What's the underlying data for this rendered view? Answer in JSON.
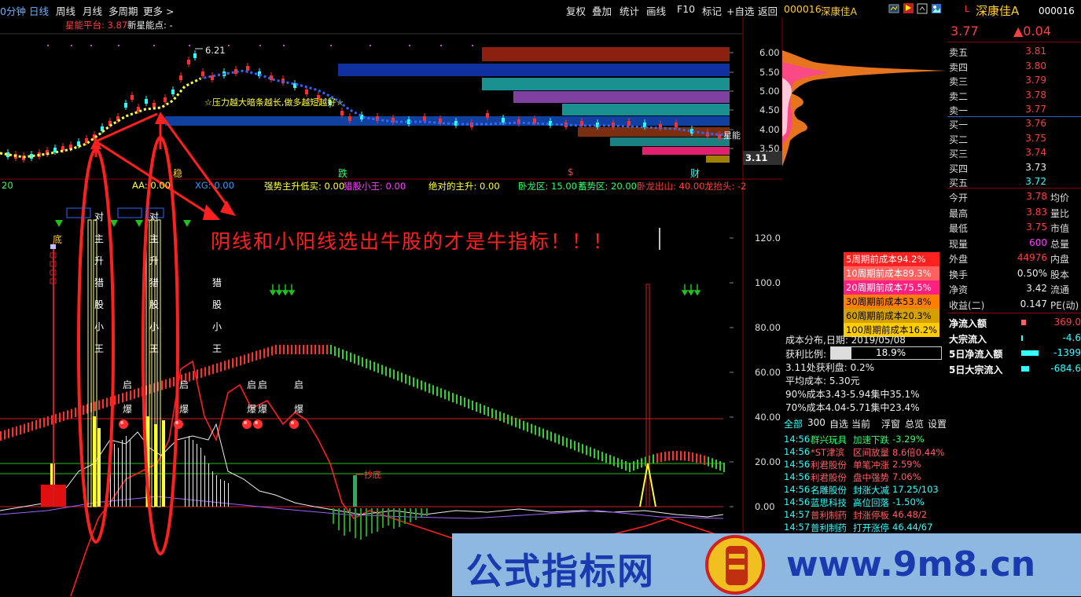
{
  "toolbar": {
    "left_items": [
      "0分钟",
      "日线",
      "周线",
      "月线",
      "多周期",
      "更多 >"
    ],
    "right_items": [
      "复权",
      "叠加",
      "统计",
      "画线",
      "F10",
      "标记",
      "+自选",
      "返回"
    ],
    "stock_code": "000016",
    "stock_name": "深康佳A"
  },
  "price_chart": {
    "indicator_label": "星能平台: 3.87",
    "indicator_label2": "新星能点: -",
    "high_marker": "6.21",
    "annotation": "☆压力越大暗条越长,做多越短越好☆",
    "y_axis": [
      "6.00",
      "5.50",
      "5.00",
      "4.50",
      "4.00",
      "3.50"
    ],
    "current_price_tag": "3.11",
    "side_label": "星能",
    "bottom_labels": [
      "稳",
      "跌",
      "$",
      "财"
    ]
  },
  "indicator_bar": {
    "items": [
      {
        "text": "20",
        "color": "#33ff66"
      },
      {
        "text": "AA: 0.00",
        "color": "#ffff33"
      },
      {
        "text": "XG: 0.00",
        "color": "#3399ff"
      },
      {
        "text": "强势主升低买: 0.00",
        "color": "#ffff33"
      },
      {
        "text": "猎股小王: 0.00",
        "color": "#ff40ff"
      },
      {
        "text": "绝对的主升: 0.00",
        "color": "#ffff33"
      },
      {
        "text": "卧龙区: 15.00",
        "color": "#33ff66"
      },
      {
        "text": "蓄势区: 20.00",
        "color": "#33ff66"
      },
      {
        "text": "卧龙出山: 40.00",
        "color": "#ff4040"
      },
      {
        "text": "龙抬头: -2",
        "color": "#ff4040"
      }
    ]
  },
  "lower_chart": {
    "headline": "阴线和小阳线选出牛股的才是牛指标！！！",
    "y_axis": [
      "120.0",
      "100.0",
      "80.00",
      "60.00",
      "40.00",
      "20.00",
      "0.00"
    ],
    "labels_bottom": "底",
    "vertical_text_1": [
      "对",
      "主",
      "升",
      "猎",
      "股",
      "小",
      "王"
    ],
    "vertical_text_2": [
      "对",
      "主",
      "升",
      "猎",
      "股",
      "小",
      "王"
    ],
    "vertical_text_3": [
      "猎",
      "股",
      "小",
      "王"
    ],
    "qibao": [
      "启",
      "爆"
    ],
    "yichao": "一抄底",
    "dots": "●"
  },
  "cost_distribution": {
    "boxes": [
      {
        "text": "5周期前成本94.2%",
        "color": "#ff2020",
        "fg": "#ffffff"
      },
      {
        "text": "10周期前成本89.3%",
        "color": "#ff6060",
        "fg": "#ffffff"
      },
      {
        "text": "20周期前成本75.5%",
        "color": "#ff2080",
        "fg": "#ffffff"
      },
      {
        "text": "30周期前成本53.8%",
        "color": "#ff7f00",
        "fg": "#000000"
      },
      {
        "text": "60周期前成本20.3%",
        "color": "#d4a000",
        "fg": "#000000"
      },
      {
        "text": "100周期前成本16.2%",
        "color": "#ffcc00",
        "fg": "#000000"
      }
    ],
    "date_line": "成本分布,日期: 2019/05/08",
    "profit_label": "获利比例:",
    "profit_value": "18.9%",
    "profit_fraction": 0.189,
    "profit_at": "3.11处获利盘: 0.2%",
    "avg_cost": "平均成本: 5.30元",
    "c90": "90%成本3.43-5.94集中35.1%",
    "c70": "70%成本4.04-5.71集中23.4%"
  },
  "ticker": {
    "tabs": [
      "全部",
      "300",
      "自选",
      "当前",
      "浮窗",
      "总览",
      "设置"
    ],
    "rows": [
      {
        "time": "14:56",
        "name": "群兴玩具",
        "event": "加速下跌",
        "value": "-3.29%",
        "color": "#33ff66"
      },
      {
        "time": "14:56",
        "name": "*ST津滨",
        "event": "区间放量",
        "value": "8.6倍0.44%",
        "color": "#ff6060"
      },
      {
        "time": "14:56",
        "name": "利君股份",
        "event": "单笔冲涨",
        "value": "2.59%",
        "color": "#ff6060"
      },
      {
        "time": "14:56",
        "name": "利君股份",
        "event": "盘中强势",
        "value": "7.06%",
        "color": "#ff6060"
      },
      {
        "time": "14:56",
        "name": "名雕股份",
        "event": "封涨大减",
        "value": "17.25/103",
        "color": "#33ffff"
      },
      {
        "time": "14:56",
        "name": "蓝思科技",
        "event": "高位回落",
        "value": "-1.50%",
        "color": "#33ffff"
      },
      {
        "time": "14:57",
        "name": "普利制药",
        "event": "封涨停板",
        "value": "46.48/2",
        "color": "#ff6060"
      },
      {
        "time": "14:57",
        "name": "普利制药",
        "event": "打开涨停",
        "value": "46.44/67",
        "color": "#33ffff"
      }
    ]
  },
  "quote": {
    "code": "000016",
    "name": "深康佳A",
    "price": "3.77",
    "change": "▲0.04",
    "asks": [
      {
        "label": "卖五",
        "price": "3.81"
      },
      {
        "label": "卖四",
        "price": "3.80"
      },
      {
        "label": "卖三",
        "price": "3.79"
      },
      {
        "label": "卖二",
        "price": "3.78"
      },
      {
        "label": "卖一",
        "price": "3.77"
      }
    ],
    "bids": [
      {
        "label": "买一",
        "price": "3.76"
      },
      {
        "label": "买二",
        "price": "3.75"
      },
      {
        "label": "买三",
        "price": "3.74"
      },
      {
        "label": "买四",
        "price": "3.73"
      },
      {
        "label": "买五",
        "price": "3.72"
      }
    ],
    "stats": [
      {
        "l": "今开",
        "v": "3.78",
        "r": "均价",
        "c": "#ff4040"
      },
      {
        "l": "最高",
        "v": "3.83",
        "r": "量比",
        "c": "#ff4040"
      },
      {
        "l": "最低",
        "v": "3.75",
        "r": "市值",
        "c": "#ff4040"
      },
      {
        "l": "现量",
        "v": "600",
        "r": "总量",
        "c": "#ff40ff"
      },
      {
        "l": "外盘",
        "v": "44976",
        "r": "内盘",
        "c": "#ff4040"
      },
      {
        "l": "换手",
        "v": "0.50%",
        "r": "股本",
        "c": "#ececec"
      },
      {
        "l": "净资",
        "v": "3.42",
        "r": "流通",
        "c": "#ececec"
      },
      {
        "l": "收益(二)",
        "v": "0.147",
        "r": "PE(动)",
        "c": "#ececec"
      }
    ],
    "flows": [
      {
        "l": "净流入额",
        "v": "369.0",
        "c": "#ff4040",
        "bar": "#ff6060"
      },
      {
        "l": "大宗流入",
        "v": "-4.6",
        "c": "#33ffff",
        "bar": "#33ffff"
      },
      {
        "l": "5日净流入额",
        "v": "-1399",
        "c": "#33ffff",
        "bar": "#33ffff"
      },
      {
        "l": "5日大宗流入",
        "v": "-684.6",
        "c": "#33ffff",
        "bar": "#33ffff"
      }
    ]
  },
  "watermark": {
    "title": "公式指标网",
    "url": "www.9m8.cn"
  }
}
